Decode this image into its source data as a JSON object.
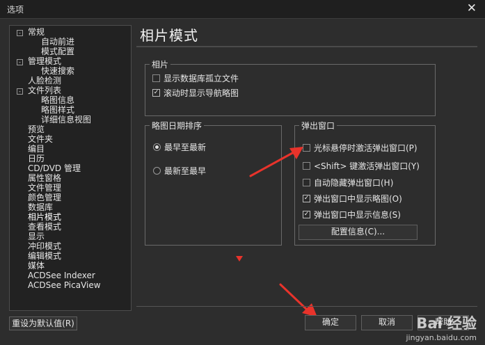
{
  "window": {
    "title": "选项",
    "close_glyph": "✕"
  },
  "tree": {
    "nodes": [
      {
        "label": "常规",
        "level": 0,
        "toggle": "-"
      },
      {
        "label": "自动前进",
        "level": 2
      },
      {
        "label": "模式配置",
        "level": 2
      },
      {
        "label": "管理模式",
        "level": 0,
        "toggle": "-"
      },
      {
        "label": "快速搜索",
        "level": 2
      },
      {
        "label": "人脸检测",
        "level": 0
      },
      {
        "label": "文件列表",
        "level": 0,
        "toggle": "-"
      },
      {
        "label": "略图信息",
        "level": 2
      },
      {
        "label": "略图样式",
        "level": 2
      },
      {
        "label": "详细信息视图",
        "level": 2
      },
      {
        "label": "预览",
        "level": 0
      },
      {
        "label": "文件夹",
        "level": 0
      },
      {
        "label": "编目",
        "level": 0
      },
      {
        "label": "日历",
        "level": 0
      },
      {
        "label": "CD/DVD 管理",
        "level": 0
      },
      {
        "label": "属性窗格",
        "level": 0
      },
      {
        "label": "文件管理",
        "level": 0
      },
      {
        "label": "颜色管理",
        "level": 0
      },
      {
        "label": "数据库",
        "level": 0
      },
      {
        "label": "相片模式",
        "level": 0,
        "selected": true
      },
      {
        "label": "查看模式",
        "level": 0
      },
      {
        "label": "显示",
        "level": 0
      },
      {
        "label": "冲印模式",
        "level": 0
      },
      {
        "label": "编辑模式",
        "level": 0
      },
      {
        "label": "媒体",
        "level": 0
      },
      {
        "label": "ACDSee Indexer",
        "level": 0
      },
      {
        "label": "ACDSee PicaView",
        "level": 0
      }
    ]
  },
  "page": {
    "heading": "相片模式"
  },
  "photo_group": {
    "legend": "相片",
    "show_db_orphans": {
      "label": "显示数据库孤立文件",
      "checked": false
    },
    "show_nav_on_scroll": {
      "label": "滚动时显示导航略图",
      "checked": true
    }
  },
  "sort_group": {
    "legend": "略图日期排序",
    "oldest_first": {
      "label": "最早至最新",
      "selected": true
    },
    "newest_first": {
      "label": "最新至最早",
      "selected": false
    }
  },
  "popup_group": {
    "legend": "弹出窗口",
    "hover_activate": {
      "label": "光标悬停时激活弹出窗口(P)",
      "checked": false
    },
    "shift_activate": {
      "label": "<Shift> 键激活弹出窗口(Y)",
      "checked": false
    },
    "auto_hide": {
      "label": "自动隐藏弹出窗口(H)",
      "checked": false
    },
    "show_thumb": {
      "label": "弹出窗口中显示略图(O)",
      "checked": true
    },
    "show_info": {
      "label": "弹出窗口中显示信息(S)",
      "checked": true
    },
    "config_button": "配置信息(C)..."
  },
  "footer": {
    "reset_button": "重设为默认值(R)",
    "ok_button": "确定",
    "cancel_button": "取消",
    "help_button": "帮助"
  },
  "watermark": {
    "brand": "Bai 经验",
    "url": "jingyan.baidu.com"
  },
  "colors": {
    "annotation_red": "#e8332b",
    "background": "#2d2d2d"
  },
  "icons": {
    "checkbox_checked": "✓",
    "tree_collapse": "-"
  }
}
